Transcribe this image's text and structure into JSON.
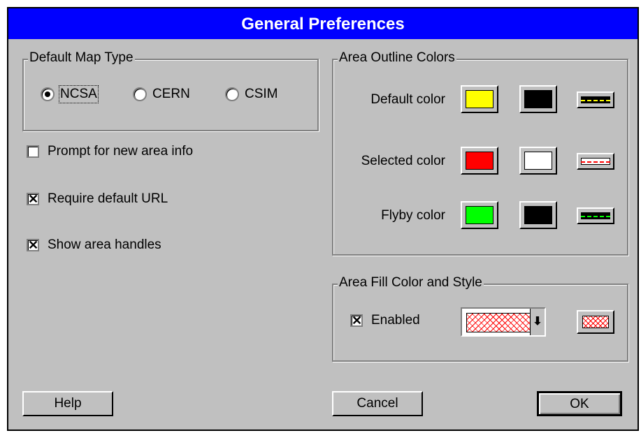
{
  "window": {
    "title": "General Preferences"
  },
  "map_type": {
    "label": "Default Map Type",
    "options": [
      {
        "label": "NCSA",
        "selected": true
      },
      {
        "label": "CERN",
        "selected": false
      },
      {
        "label": "CSIM",
        "selected": false
      }
    ]
  },
  "checks": [
    {
      "label": "Prompt for new area info",
      "checked": false
    },
    {
      "label": "Require default URL",
      "checked": true
    },
    {
      "label": "Show area handles",
      "checked": true
    }
  ],
  "outline": {
    "label": "Area Outline Colors",
    "rows": [
      {
        "label": "Default color",
        "primary": "#ffff00",
        "secondary": "#000000",
        "dash": "#ffff00"
      },
      {
        "label": "Selected color",
        "primary": "#ff0000",
        "secondary": "#ffffff",
        "dash": "#ff0000"
      },
      {
        "label": "Flyby color",
        "primary": "#00ff00",
        "secondary": "#000000",
        "dash": "#00ff00"
      }
    ]
  },
  "fill": {
    "label": "Area Fill Color and Style",
    "enabled_label": "Enabled",
    "enabled": true,
    "pattern_color": "#ff0000"
  },
  "buttons": {
    "help": "Help",
    "cancel": "Cancel",
    "ok": "OK"
  }
}
